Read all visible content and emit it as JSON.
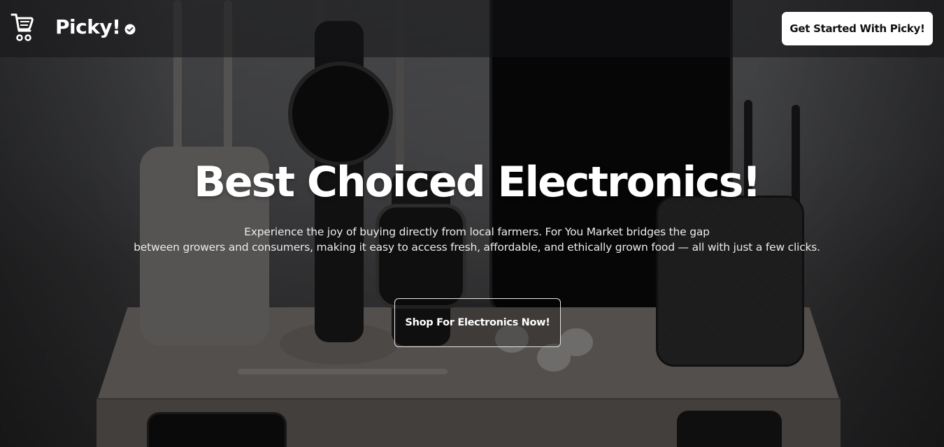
{
  "navbar": {
    "logo_icon": "shopping-cart-icon",
    "brand_name": "Picky!",
    "verified_icon": "check-badge-icon",
    "cta_label": "Get Started With Picky!"
  },
  "hero": {
    "headline": "Best Choiced Electronics!",
    "subtext_line1": "Experience the joy of buying directly from local farmers. For You Market bridges the gap",
    "subtext_line2": "between growers and consumers, making it easy to access fresh, affordable, and ethically grown food — all with just a few clicks.",
    "cta_label": "Shop For Electronics Now!"
  },
  "colors": {
    "overlay": "#000000",
    "text": "#ffffff",
    "button_bg": "#ffffff",
    "button_text": "#111111"
  }
}
